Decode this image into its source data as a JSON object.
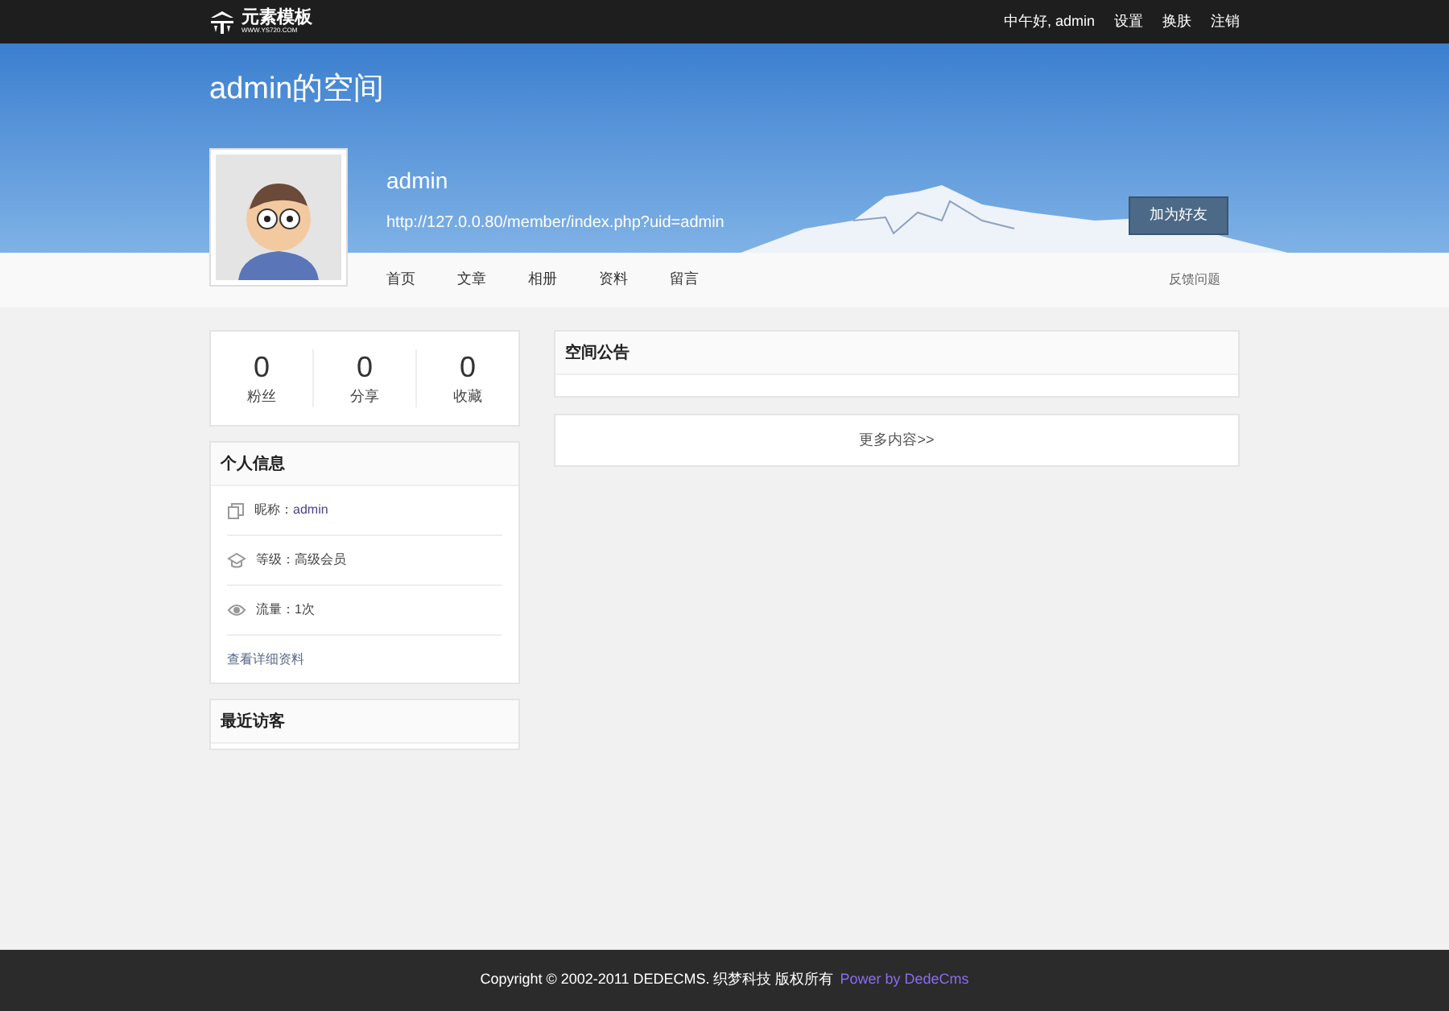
{
  "topbar": {
    "logo": {
      "name": "元素模板",
      "url": "WWW.YS720.COM"
    },
    "greeting": "中午好, admin",
    "links": [
      "设置",
      "换肤",
      "注销"
    ]
  },
  "banner": {
    "title": "admin的空间",
    "username": "admin",
    "url": "http://127.0.0.80/member/index.php?uid=admin",
    "add_friend": "加为好友"
  },
  "nav": {
    "items": [
      {
        "label": "首页",
        "selected": false
      },
      {
        "label": "文章",
        "selected": false
      },
      {
        "label": "相册",
        "selected": false
      },
      {
        "label": "资料",
        "selected": false
      },
      {
        "label": "留言",
        "selected": false
      }
    ],
    "feedback": "反馈问题"
  },
  "stats": [
    {
      "value": "0",
      "label": "粉丝"
    },
    {
      "value": "0",
      "label": "分享"
    },
    {
      "value": "0",
      "label": "收藏"
    }
  ],
  "personal_info": {
    "title": "个人信息",
    "rows": [
      {
        "kind": "nickname",
        "label": "昵称：",
        "value": "admin"
      },
      {
        "kind": "level",
        "label": "等级：",
        "value": "高级会员"
      },
      {
        "kind": "traffic",
        "label": "流量：",
        "value": "1次"
      }
    ],
    "more_link": "查看详细资料"
  },
  "recent_visitors": {
    "title": "最近访客"
  },
  "announcement": {
    "title": "空间公告"
  },
  "more_content": "更多内容>>",
  "footer": {
    "text": "Copyright © 2002-2011 DEDECMS. 织梦科技 版权所有",
    "link": "Power by DedeCms"
  }
}
